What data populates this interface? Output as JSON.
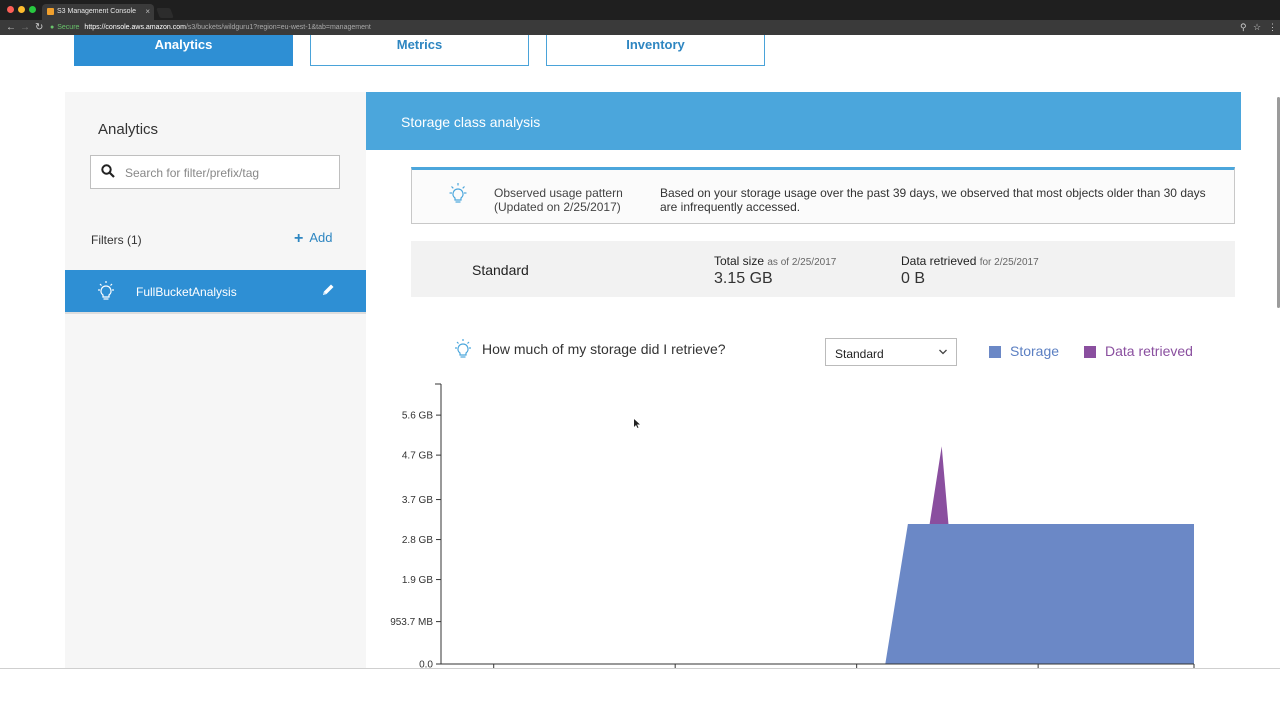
{
  "browser": {
    "tab_title": "S3 Management Console",
    "tab_close": "×",
    "secure_label": "Secure",
    "url_host": "https://console.aws.amazon.com",
    "url_path": "/s3/buckets/wildguru1?region=eu-west-1&tab=management"
  },
  "top_tabs": [
    {
      "label": "Analytics",
      "active": true
    },
    {
      "label": "Metrics",
      "active": false
    },
    {
      "label": "Inventory",
      "active": false
    }
  ],
  "sidebar": {
    "title": "Analytics",
    "search_placeholder": "Search for filter/prefix/tag",
    "filters_label": "Filters (1)",
    "add_label": "Add",
    "filter_name": "FullBucketAnalysis"
  },
  "panel": {
    "title": "Storage class analysis",
    "info_label": "Observed usage pattern (Updated on 2/25/2017)",
    "info_desc": "Based on your storage usage over the past 39 days, we observed that most objects older than 30 days are infrequently accessed."
  },
  "summary": {
    "storage_class": "Standard",
    "total_size_label": "Total size",
    "total_size_note": "as of 2/25/2017",
    "total_size_value": "3.15 GB",
    "retrieved_label": "Data retrieved",
    "retrieved_note": "for 2/25/2017",
    "retrieved_value": "0 B"
  },
  "chart_section": {
    "question": "How much of my storage did I retrieve?",
    "select_value": "Standard"
  },
  "colors": {
    "accent": "#2e8fd4",
    "storage": "#6b88c6",
    "data_retrieved": "#8a4f9f"
  },
  "chart_data": {
    "type": "area",
    "y_ticks": [
      "5.6 GB",
      "4.7 GB",
      "3.7 GB",
      "2.8 GB",
      "1.9 GB",
      "953.7 MB",
      "0.0"
    ],
    "y_tick_values_gb": [
      5.6,
      4.7,
      3.7,
      2.8,
      1.9,
      0.9537,
      0.0
    ],
    "ylim_gb": [
      0,
      6.3
    ],
    "x": [
      0,
      0.59,
      0.62,
      0.665,
      0.69,
      1.0
    ],
    "series": [
      {
        "name": "Storage",
        "values": [
          0,
          0,
          3.15,
          3.15,
          3.15,
          3.15
        ]
      },
      {
        "name": "Data retrieved",
        "values": [
          0,
          0,
          0,
          4.9,
          0,
          0
        ]
      }
    ],
    "legend": "top-right",
    "grid": false
  }
}
